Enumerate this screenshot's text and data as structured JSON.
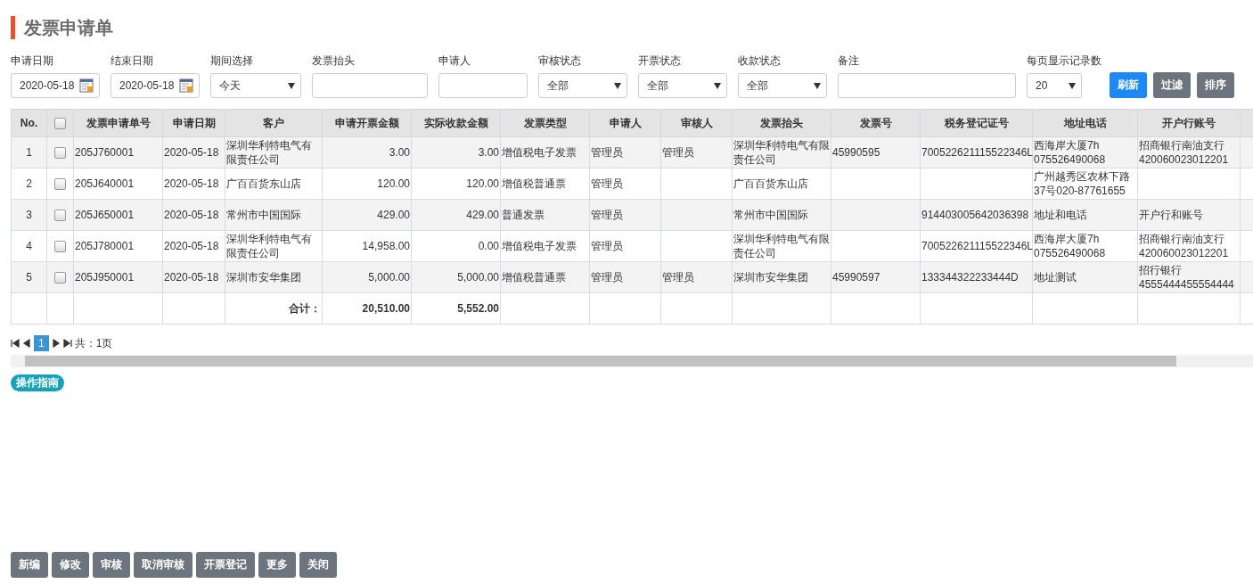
{
  "title": "发票申请单",
  "filters": [
    {
      "label": "申请日期",
      "kind": "date",
      "value": "2020-05-18"
    },
    {
      "label": "结束日期",
      "kind": "date",
      "value": "2020-05-18"
    },
    {
      "label": "期间选择",
      "kind": "select",
      "value": "今天"
    },
    {
      "label": "发票抬头",
      "kind": "text"
    },
    {
      "label": "申请人",
      "kind": "text"
    },
    {
      "label": "审核状态",
      "kind": "select",
      "value": "全部"
    },
    {
      "label": "开票状态",
      "kind": "select",
      "value": "全部"
    },
    {
      "label": "收款状态",
      "kind": "select",
      "value": "全部"
    },
    {
      "label": "备注",
      "kind": "text"
    },
    {
      "label": "每页显示记录数",
      "kind": "select",
      "value": "20"
    }
  ],
  "filter_buttons": [
    {
      "label": "刷新",
      "kind": "primary"
    },
    {
      "label": "过滤",
      "kind": "secondary"
    },
    {
      "label": "排序",
      "kind": "secondary"
    }
  ],
  "table": {
    "header_checked": false,
    "columns": [
      {
        "label": "No.",
        "kind": "index"
      },
      {
        "kind": "check"
      },
      {
        "label": "发票申请单号",
        "kind": "text"
      },
      {
        "label": "申请日期",
        "kind": "text"
      },
      {
        "label": "客户",
        "kind": "text"
      },
      {
        "label": "申请开票金额",
        "kind": "number"
      },
      {
        "label": "实际收款金额",
        "kind": "number"
      },
      {
        "label": "发票类型",
        "kind": "text"
      },
      {
        "label": "申请人",
        "kind": "text"
      },
      {
        "label": "审核人",
        "kind": "text"
      },
      {
        "label": "发票抬头",
        "kind": "text"
      },
      {
        "label": "发票号",
        "kind": "text"
      },
      {
        "label": "税务登记证号",
        "kind": "text"
      },
      {
        "label": "地址电话",
        "kind": "text"
      },
      {
        "label": "开户行账号",
        "kind": "text"
      }
    ],
    "rows": [
      {
        "checked": false,
        "cells": [
          "1",
          null,
          "205J760001",
          "2020-05-18",
          "深圳华利特电气有限责任公司",
          "3.00",
          "3.00",
          "增值税电子发票",
          "管理员",
          "管理员",
          "深圳华利特电气有限责任公司",
          "45990595",
          "700522621115522346L",
          "西海岸大厦7h 075526490068",
          "招商银行南油支行 420060023012201"
        ]
      },
      {
        "checked": false,
        "cells": [
          "2",
          null,
          "205J640001",
          "2020-05-18",
          "广百百货东山店",
          "120.00",
          "120.00",
          "增值税普通票",
          "管理员",
          null,
          "广百百货东山店",
          null,
          null,
          "广州越秀区农林下路37号020-87761655",
          null
        ]
      },
      {
        "checked": false,
        "cells": [
          "3",
          null,
          "205J650001",
          "2020-05-18",
          "常州市中国国际",
          "429.00",
          "429.00",
          "普通发票",
          "管理员",
          null,
          "常州市中国国际",
          null,
          "914403005642036398",
          "地址和电话",
          "开户行和账号"
        ]
      },
      {
        "checked": false,
        "cells": [
          "4",
          null,
          "205J780001",
          "2020-05-18",
          "深圳华利特电气有限责任公司",
          "14,958.00",
          "0.00",
          "增值税电子发票",
          "管理员",
          null,
          "深圳华利特电气有限责任公司",
          null,
          "700522621115522346L",
          "西海岸大厦7h 075526490068",
          "招商银行南油支行 420060023012201"
        ]
      },
      {
        "checked": false,
        "cells": [
          "5",
          null,
          "205J950001",
          "2020-05-18",
          "深圳市安华集团",
          "5,000.00",
          "5,000.00",
          "增值税普通票",
          "管理员",
          "管理员",
          "深圳市安华集团",
          "45990597",
          "133344322233444D",
          "地址测试",
          "招行银行 4555444455554444"
        ]
      }
    ],
    "totals": {
      "label": "合计：",
      "requested": "20,510.00",
      "received": "5,552.00"
    }
  },
  "pagination": {
    "pages": [
      {
        "label": "1",
        "selected": true
      }
    ],
    "summary": "共：1页"
  },
  "guide_badge": "操作指南",
  "actions": [
    "新编",
    "修改",
    "审核",
    "取消审核",
    "开票登记",
    "更多",
    "关闭"
  ]
}
